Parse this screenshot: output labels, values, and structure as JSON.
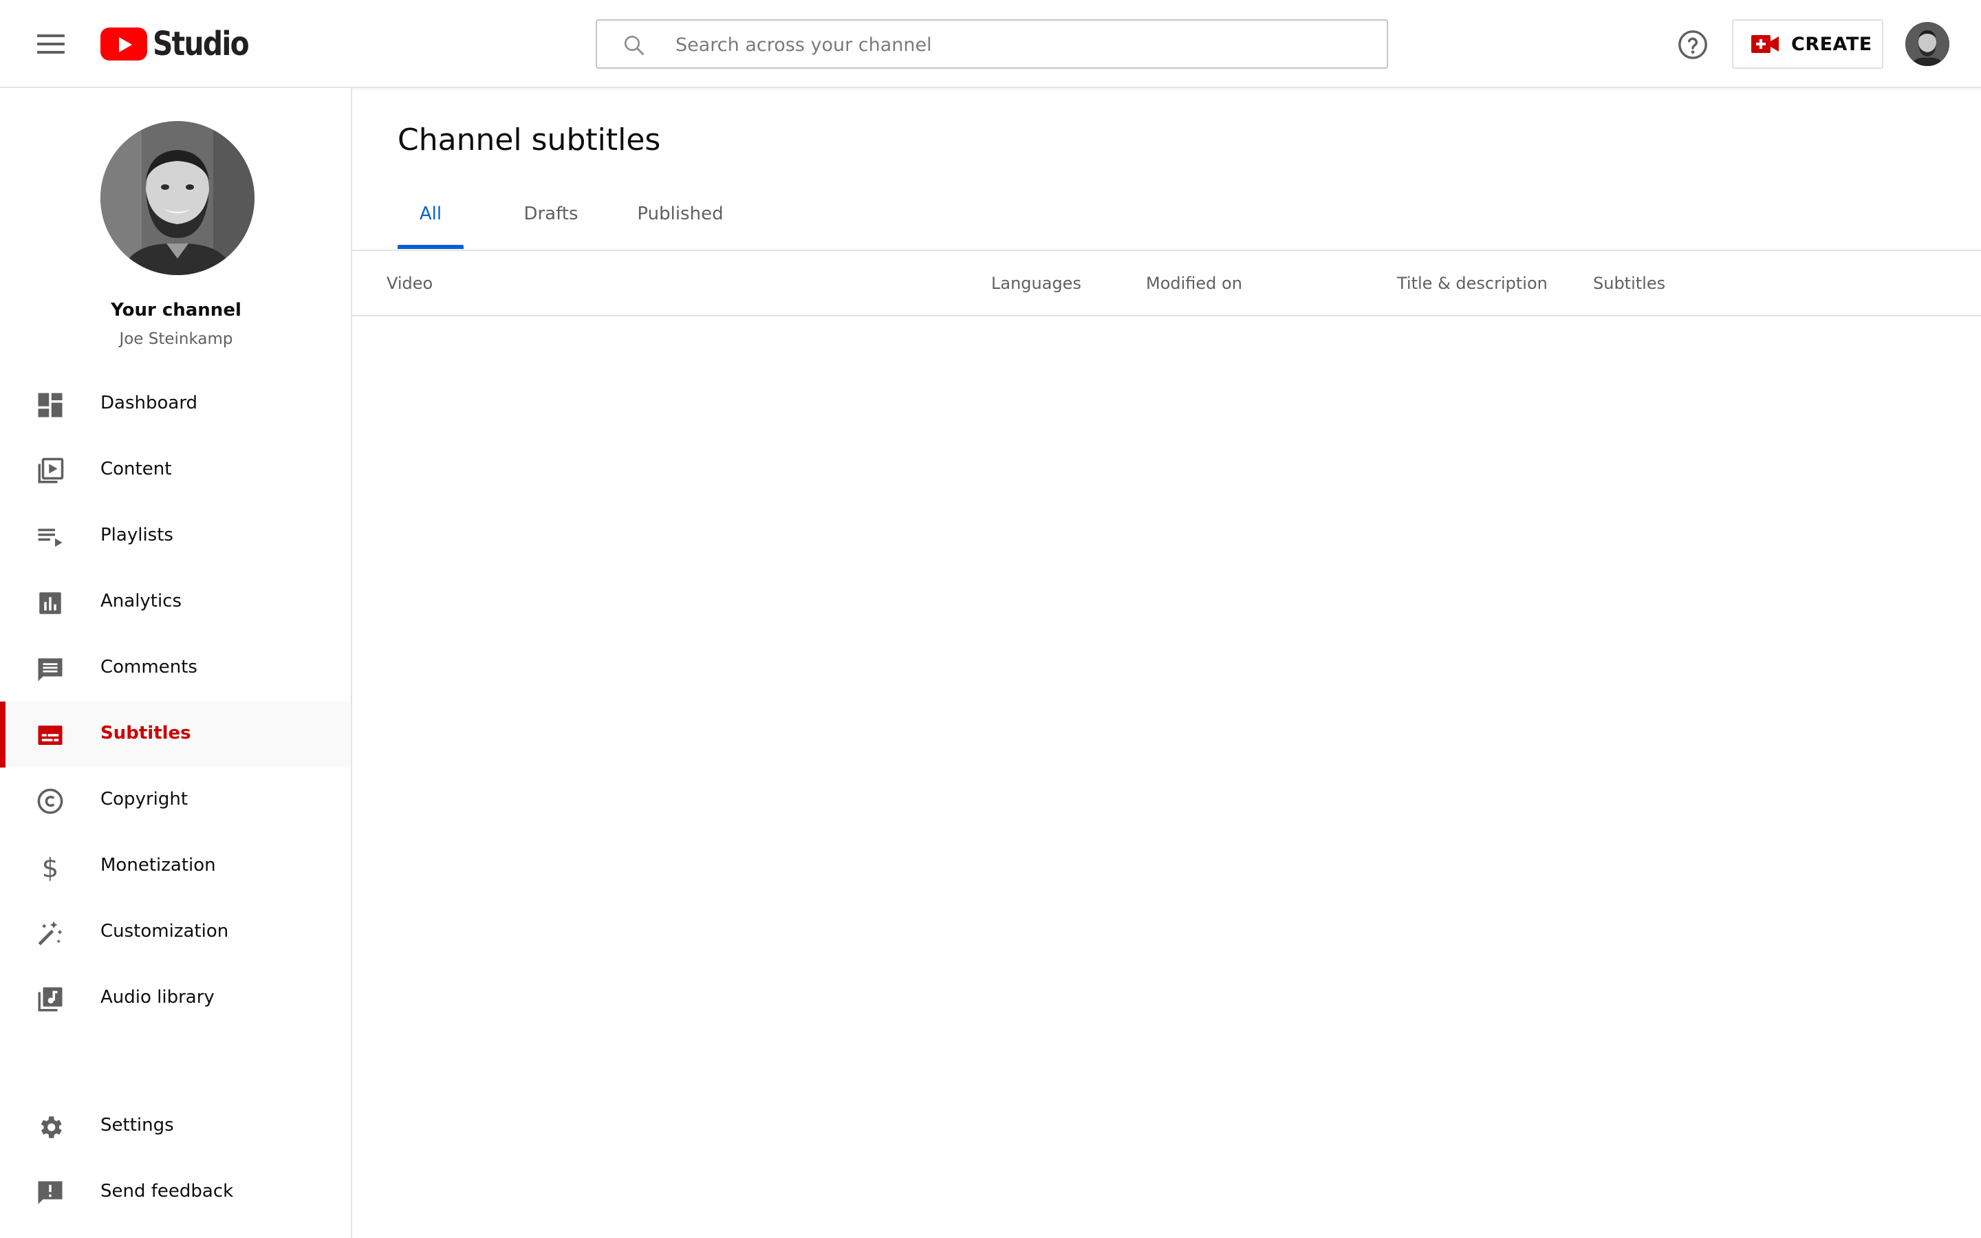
{
  "topbar": {
    "logo_text": "Studio",
    "search_placeholder": "Search across your channel",
    "create_label": "CREATE"
  },
  "channel": {
    "title": "Your channel",
    "name": "Joe Steinkamp"
  },
  "sidebar": {
    "items": [
      {
        "label": "Dashboard",
        "icon": "dashboard-icon"
      },
      {
        "label": "Content",
        "icon": "content-icon"
      },
      {
        "label": "Playlists",
        "icon": "playlists-icon"
      },
      {
        "label": "Analytics",
        "icon": "analytics-icon"
      },
      {
        "label": "Comments",
        "icon": "comments-icon"
      },
      {
        "label": "Subtitles",
        "icon": "subtitles-icon",
        "active": true
      },
      {
        "label": "Copyright",
        "icon": "copyright-icon"
      },
      {
        "label": "Monetization",
        "icon": "monetization-icon"
      },
      {
        "label": "Customization",
        "icon": "customization-icon"
      },
      {
        "label": "Audio library",
        "icon": "audio-library-icon"
      }
    ],
    "bottom_items": [
      {
        "label": "Settings",
        "icon": "gear-icon"
      },
      {
        "label": "Send feedback",
        "icon": "feedback-icon"
      }
    ]
  },
  "main": {
    "title": "Channel subtitles",
    "tabs": [
      {
        "label": "All",
        "active": true
      },
      {
        "label": "Drafts"
      },
      {
        "label": "Published"
      }
    ],
    "columns": [
      "Video",
      "Languages",
      "Modified on",
      "Title & description",
      "Subtitles"
    ]
  },
  "colors": {
    "accent_red": "#cc0000",
    "tab_blue": "#065fd4",
    "icon_gray": "#606060"
  }
}
